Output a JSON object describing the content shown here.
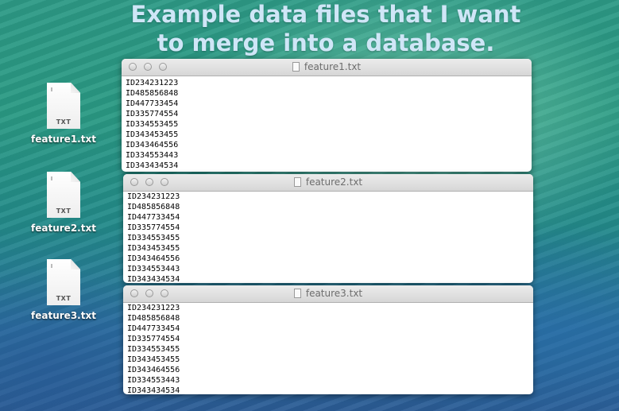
{
  "headline": {
    "line1": "Example data files that I want",
    "line2": "to merge into a database."
  },
  "desktop_icons": [
    {
      "filename": "feature1.txt",
      "ext": "TXT",
      "icon": "txt-file-icon"
    },
    {
      "filename": "feature2.txt",
      "ext": "TXT",
      "icon": "txt-file-icon"
    },
    {
      "filename": "feature3.txt",
      "ext": "TXT",
      "icon": "txt-file-icon"
    }
  ],
  "windows": [
    {
      "title": "feature1.txt",
      "lines": [
        "ID234231223",
        "ID485856848",
        "ID447733454",
        "ID335774554",
        "ID334553455",
        "ID343453455",
        "ID343464556",
        "ID334553443",
        "ID343434534"
      ]
    },
    {
      "title": "feature2.txt",
      "lines": [
        "ID234231223",
        "ID485856848",
        "ID447733454",
        "ID335774554",
        "ID334553455",
        "ID343453455",
        "ID343464556",
        "ID334553443",
        "ID343434534"
      ]
    },
    {
      "title": "feature3.txt",
      "lines": [
        "ID234231223",
        "ID485856848",
        "ID447733454",
        "ID335774554",
        "ID334553455",
        "ID343453455",
        "ID343464556",
        "ID334553443",
        "ID343434534"
      ]
    }
  ]
}
